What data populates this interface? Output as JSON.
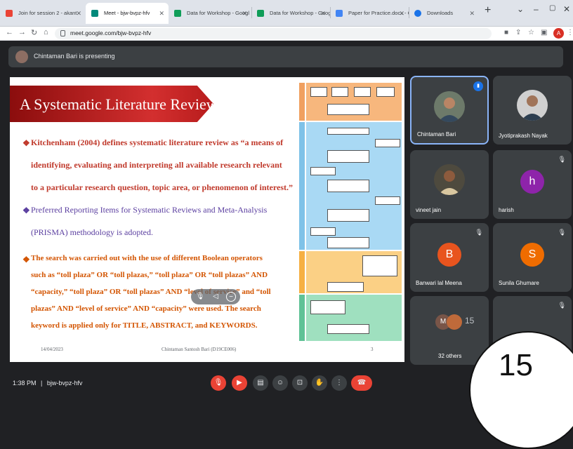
{
  "browser": {
    "tabs": [
      {
        "label": "Join for session 2 - akant.",
        "active": false,
        "fav_color": "#ea4335"
      },
      {
        "label": "Meet - bjw-bvpz-hfv",
        "active": true,
        "fav_color": "#00897b"
      },
      {
        "label": "Data for Workshop - Googl",
        "active": false,
        "fav_color": "#0f9d58"
      },
      {
        "label": "Data for Workshop - Googl",
        "active": false,
        "fav_color": "#0f9d58"
      },
      {
        "label": "Paper for Practice.docx - G",
        "active": false,
        "fav_color": "#4285f4"
      },
      {
        "label": "Downloads",
        "active": false,
        "fav_color": "#1a73e8"
      }
    ],
    "url": "meet.google.com/bjw-bvpz-hfv",
    "profile_initial": "A"
  },
  "presenting_banner": "Chintaman Bari is presenting",
  "slide": {
    "title": "A Systematic Literature Review",
    "para1_lines": [
      "Kitchenham (2004) defines systematic literature review as “a means of",
      "identifying, evaluating and interpreting all available research relevant",
      "to a particular research question, topic area, or phenomenon of interest.”"
    ],
    "para2_lines": [
      "Preferred Reporting Items for Systematic Reviews and Meta-Analysis",
      "(PRISMA) methodology is adopted."
    ],
    "para3_lines": [
      "The search was carried out with the use of different Boolean operators",
      "such as “toll plaza” OR “toll plazas,” “toll plaza” OR “toll plazas” AND",
      "“capacity,” “toll plaza” OR “toll plazas” AND “level of service” and “toll",
      "plazas” AND “level of service” AND “capacity” were used. The search",
      "keyword is applied only for TITLE, ABSTRACT, and KEYWORDS."
    ],
    "footer_date": "14/04/2023",
    "footer_author": "Chintaman Santosh Bari (D19CE006)",
    "footer_page": "3"
  },
  "participants": [
    {
      "name": "Chintaman Bari",
      "kind": "photo",
      "photo_bg": "#6d7a6a",
      "speaking": true,
      "muted": false
    },
    {
      "name": "Jyotiprakash Nayak",
      "kind": "photo",
      "photo_bg": "#c9c9c9",
      "speaking": false,
      "muted": false
    },
    {
      "name": "vineet jain",
      "kind": "photo",
      "photo_bg": "#4e4a3e",
      "speaking": false,
      "muted": true
    },
    {
      "name": "harish",
      "kind": "initial",
      "initial": "h",
      "color": "#8e24aa",
      "speaking": false,
      "muted": true
    },
    {
      "name": "Banwari lal Meena",
      "kind": "initial",
      "initial": "B",
      "color": "#e8541e",
      "speaking": false,
      "muted": true
    },
    {
      "name": "Sunila Ghumare",
      "kind": "initial",
      "initial": "S",
      "color": "#ef6c00",
      "speaking": false,
      "muted": true
    },
    {
      "name": "32 others",
      "kind": "others",
      "stack_initial": "M",
      "stack_count": "15",
      "speaking": false,
      "muted": false
    },
    {
      "name": "",
      "kind": "blank",
      "speaking": false,
      "muted": true
    }
  ],
  "bottom": {
    "time": "1:38 PM",
    "separator": "|",
    "meeting_code": "bjw-bvpz-hfv"
  },
  "overlay_badge": "15",
  "colors": {
    "meet_bg": "#202124",
    "tile_bg": "#3c4043",
    "accent_blue": "#8ab4f8",
    "end_call_red": "#ea4335"
  }
}
